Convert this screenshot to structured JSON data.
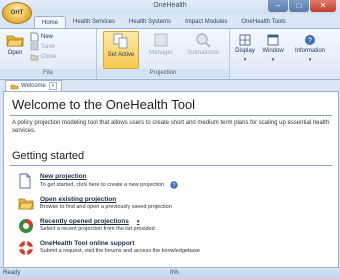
{
  "window": {
    "title": "OneHealth",
    "minimize": "–",
    "maximize": "□",
    "close": "✕"
  },
  "app_button": {
    "label": "OHT"
  },
  "tabs": [
    {
      "label": "Home"
    },
    {
      "label": "Health Services"
    },
    {
      "label": "Health Systems"
    },
    {
      "label": "Impact Modules"
    },
    {
      "label": "OneHealth Tools"
    }
  ],
  "ribbon": {
    "file": {
      "open": "Open",
      "new": "New",
      "save": "Save",
      "close": "Close",
      "group": "File"
    },
    "projection": {
      "set_active": "Set Active",
      "manager": "Manager",
      "subnational": "Subnational",
      "group": "Projection"
    },
    "view": {
      "display": "Display",
      "window": "Window",
      "information": "Information"
    }
  },
  "doc_tab": {
    "label": "Welcome"
  },
  "welcome": {
    "title": "Welcome to the OneHealth Tool",
    "description": "A policy projection modeling tool that allows users to create short and medium term plans for scaling up essential health services.",
    "getting_started": "Getting started",
    "items": [
      {
        "title": "New projection",
        "subtitle": "To get started, click here to create a new projection"
      },
      {
        "title": "Open existing projection",
        "subtitle": "Browse to find and open a previously saved projection"
      },
      {
        "title": "Recently opened projections",
        "subtitle": "Select a recent projection from the list provided"
      },
      {
        "title": "OneHealth Tool online support",
        "subtitle": "Submit a request, visit the forums and access the knowledgebase"
      }
    ]
  },
  "status": {
    "ready": "Ready",
    "progress": "0%"
  }
}
